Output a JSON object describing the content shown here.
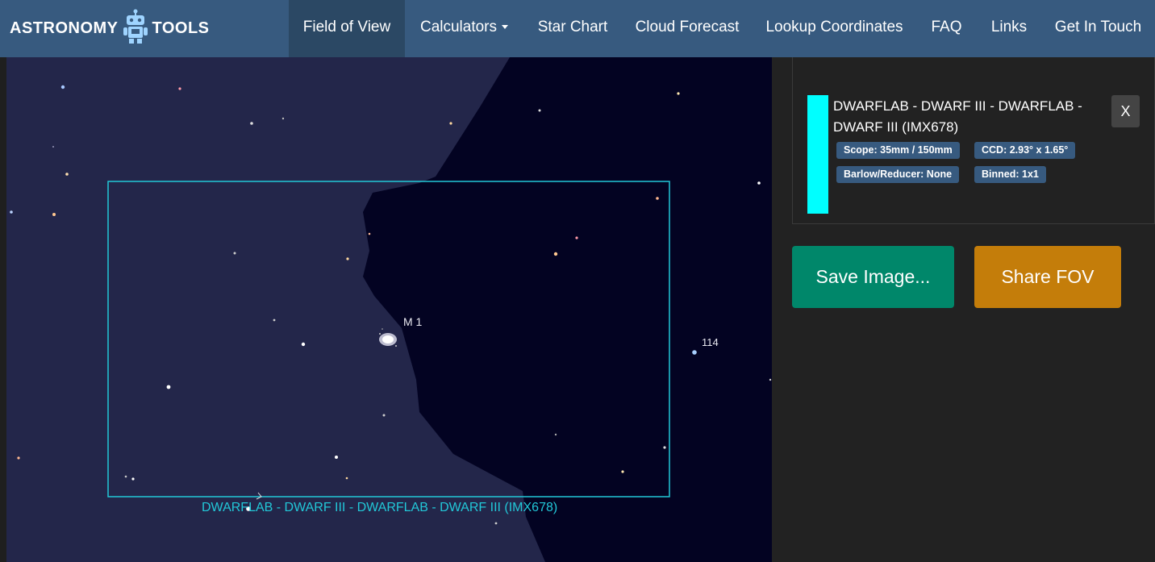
{
  "navbar": {
    "brand_left": "ASTRONOMY",
    "brand_right": "TOOLS",
    "brand_icon": "robot-icon",
    "items": [
      {
        "label": "Field of View",
        "active": true
      },
      {
        "label": "Calculators",
        "dropdown": true
      },
      {
        "label": "Star Chart"
      },
      {
        "label": "Cloud Forecast"
      },
      {
        "label": "Lookup Coordinates"
      },
      {
        "label": "FAQ"
      },
      {
        "label": "Links"
      },
      {
        "label": "Get In Touch"
      }
    ]
  },
  "sky": {
    "object_label": "M 1",
    "star_label": "114",
    "fov_label": "DWARFLAB - DWARF III - DWARFLAB - DWARF III (IMX678)"
  },
  "equipment": {
    "title": "DWARFLAB - DWARF III - DWARFLAB - DWARF III (IMX678)",
    "color": "#00ffff",
    "badges": {
      "scope": "Scope: 35mm / 150mm",
      "ccd": "CCD: 2.93° x 1.65°",
      "barlow": "Barlow/Reducer: None",
      "binned": "Binned: 1x1"
    },
    "close_label": "X"
  },
  "actions": {
    "save_label": "Save Image...",
    "share_label": "Share FOV"
  },
  "colors": {
    "navbar": "#375a7f",
    "save_button": "#00876a",
    "share_button": "#c47d0a",
    "fov_rectangle": "#22c8d8"
  }
}
